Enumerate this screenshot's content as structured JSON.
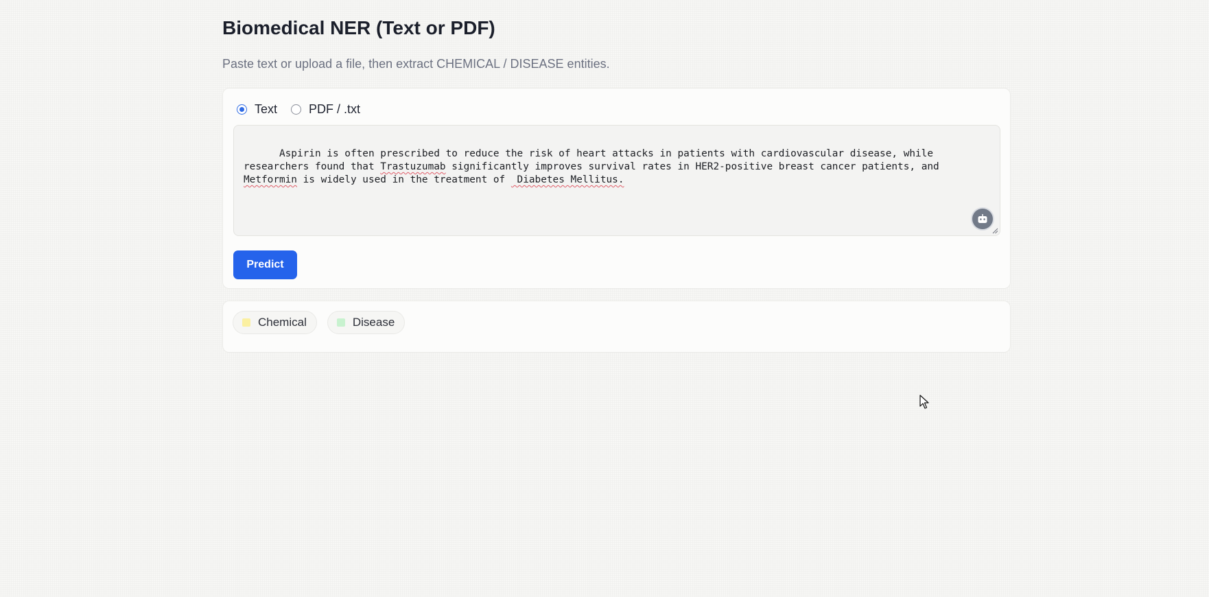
{
  "page": {
    "title": "Biomedical NER (Text or PDF)",
    "subtitle": "Paste text or upload a file, then extract CHEMICAL / DISEASE entities."
  },
  "input_mode": {
    "options": [
      {
        "label": "Text",
        "checked": true
      },
      {
        "label": "PDF / .txt",
        "checked": false
      }
    ]
  },
  "text_input": {
    "segments": [
      {
        "text": "Aspirin is often prescribed to reduce the risk of heart attacks in patients with cardiovascular disease, while researchers found that ",
        "misspelled": false
      },
      {
        "text": "Trastuzumab",
        "misspelled": true
      },
      {
        "text": " significantly improves survival rates in HER2-positive breast cancer patients, and ",
        "misspelled": false
      },
      {
        "text": "Metformin",
        "misspelled": true
      },
      {
        "text": " is widely used in the treatment of ",
        "misspelled": false
      },
      {
        "text": " Diabetes Mellitus.",
        "misspelled": true
      }
    ],
    "assistant_icon": "robot-icon",
    "resize_icon": "resize-handle-icon"
  },
  "actions": {
    "predict_label": "Predict",
    "predict_color": "#2563eb"
  },
  "legend": {
    "items": [
      {
        "label": "Chemical",
        "color": "#fbf0a1"
      },
      {
        "label": "Disease",
        "color": "#c8f2cf"
      }
    ]
  },
  "colors": {
    "accent": "#2563eb",
    "radio_checked": "#2f6be4",
    "spellcheck_underline": "#e05c68"
  }
}
